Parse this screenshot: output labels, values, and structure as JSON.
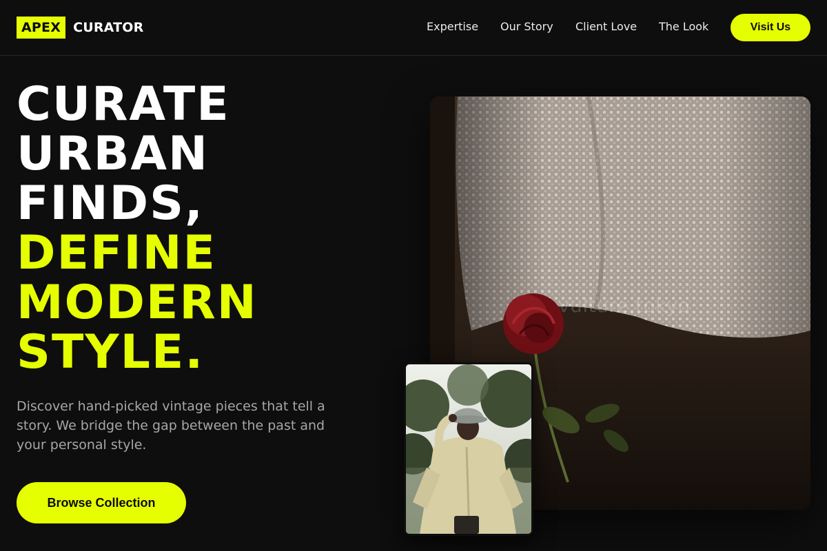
{
  "brand": {
    "badge": "APEX",
    "name": "CURATOR",
    "accent_color": "#e6ff00"
  },
  "nav": {
    "items": [
      {
        "label": "Expertise"
      },
      {
        "label": "Our Story"
      },
      {
        "label": "Client Love"
      },
      {
        "label": "The Look"
      }
    ],
    "visit_label": "Visit Us"
  },
  "hero": {
    "headline_white": [
      "CURATE",
      "URBAN",
      "FINDS,"
    ],
    "headline_accent": [
      "DEFINE",
      "MODERN",
      "STYLE."
    ],
    "description": "Discover hand-picked vintage pieces that tell a story. We bridge the gap between the past and your personal style.",
    "cta_label": "Browse Collection"
  },
  "images": {
    "main_watermark": "vulture.tokyo",
    "main_subject": "knit-sweater-with-red-rose",
    "secondary_subject": "person-in-trench-coat-and-bucket-hat"
  }
}
